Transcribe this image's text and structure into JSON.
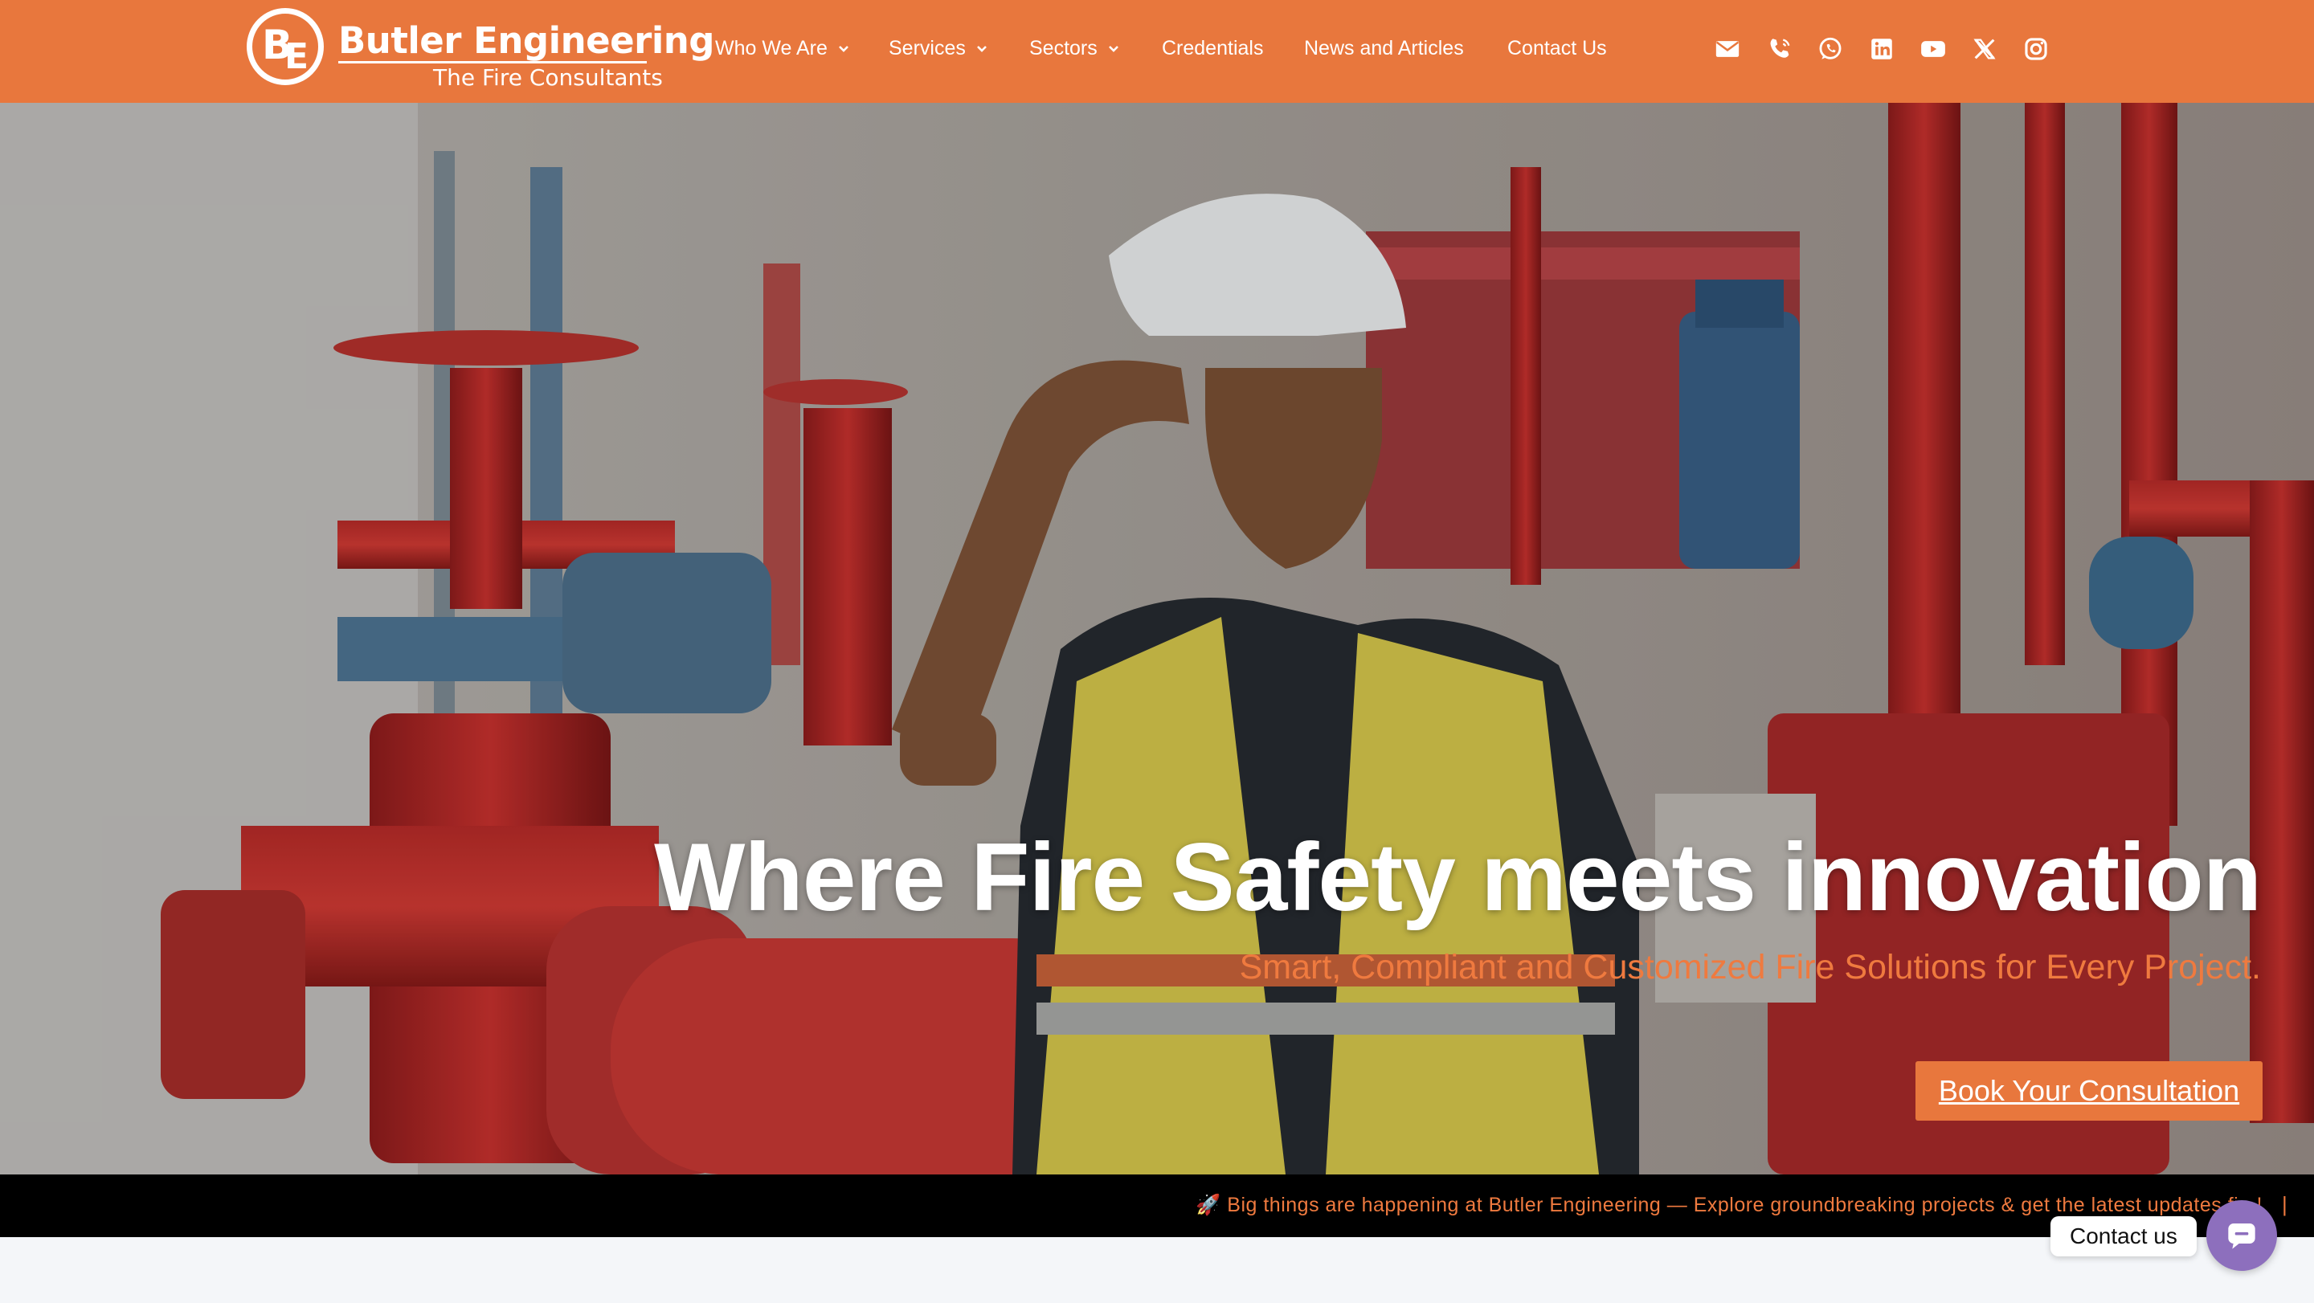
{
  "brand": {
    "mark_letters": [
      "B",
      "E"
    ],
    "name": "Butler Engineering",
    "tagline": "The Fire Consultants"
  },
  "nav": {
    "items": [
      {
        "label": "Who We Are",
        "has_dropdown": true
      },
      {
        "label": "Services",
        "has_dropdown": true
      },
      {
        "label": "Sectors",
        "has_dropdown": true
      },
      {
        "label": "Credentials",
        "has_dropdown": false
      },
      {
        "label": "News and Articles",
        "has_dropdown": false
      },
      {
        "label": "Contact Us",
        "has_dropdown": false
      }
    ]
  },
  "socials": [
    "envelope-icon",
    "phone-icon",
    "whatsapp-icon",
    "linkedin-icon",
    "youtube-icon",
    "x-icon",
    "instagram-icon"
  ],
  "hero": {
    "headline": "Where Fire Safety meets innovation",
    "subheadline": "Smart, Compliant and Customized Fire Solutions for Every Project.",
    "cta_label": "Book Your Consultation"
  },
  "ticker": {
    "icon": "rocket-icon",
    "text": "🚀 Big things are happening at Butler Engineering — Explore groundbreaking projects & get the latest updates fi...!",
    "separator": "|"
  },
  "contact_widget": {
    "label": "Contact us"
  },
  "colors": {
    "brand_orange": "#e8773d",
    "accent_orange_text": "#ef7a3f",
    "ticker_bg": "#000000",
    "widget_purple": "#8d6fbd"
  }
}
